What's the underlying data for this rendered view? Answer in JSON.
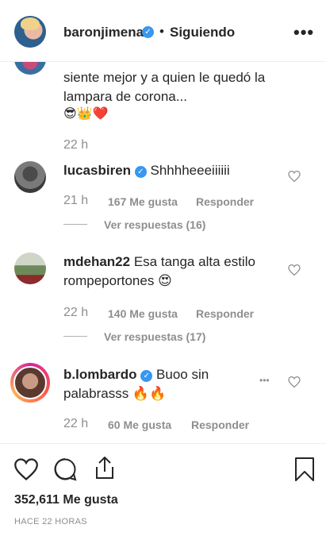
{
  "header": {
    "username": "baronjimena",
    "separator": "•",
    "follow_status": "Siguiendo",
    "more": "•••"
  },
  "comments": {
    "partial": {
      "line1": "siente mejor y a quien le quedó la",
      "line2": "lampara de corona...",
      "emojis": "😎👑❤️",
      "time": "22 h"
    },
    "items": [
      {
        "username": "lucasbiren",
        "text": "Shhhheeeiiiiii",
        "time": "21 h",
        "likes": "167 Me gusta",
        "reply": "Responder",
        "view_replies": "Ver respuestas (16)"
      },
      {
        "username": "mdehan22",
        "text_line1": "Esa tanga alta estilo",
        "text_line2": "rompeportones 😍",
        "time": "22 h",
        "likes": "140 Me gusta",
        "reply": "Responder",
        "view_replies": "Ver respuestas (17)"
      },
      {
        "username": "b.lombardo",
        "text_line1": "Buoo sin",
        "text_line2": "palabrasss 🔥🔥",
        "more": "•••",
        "time": "22 h",
        "likes": "60 Me gusta",
        "reply": "Responder"
      }
    ]
  },
  "footer": {
    "likes": "352,611 Me gusta",
    "posted": "HACE 22 HORAS"
  },
  "icons": {
    "like": "heart-icon",
    "comment": "comment-icon",
    "share": "share-icon",
    "save": "bookmark-icon"
  },
  "colors": {
    "verified": "#3897f0",
    "text": "#262626",
    "muted": "#8e8e8e"
  }
}
